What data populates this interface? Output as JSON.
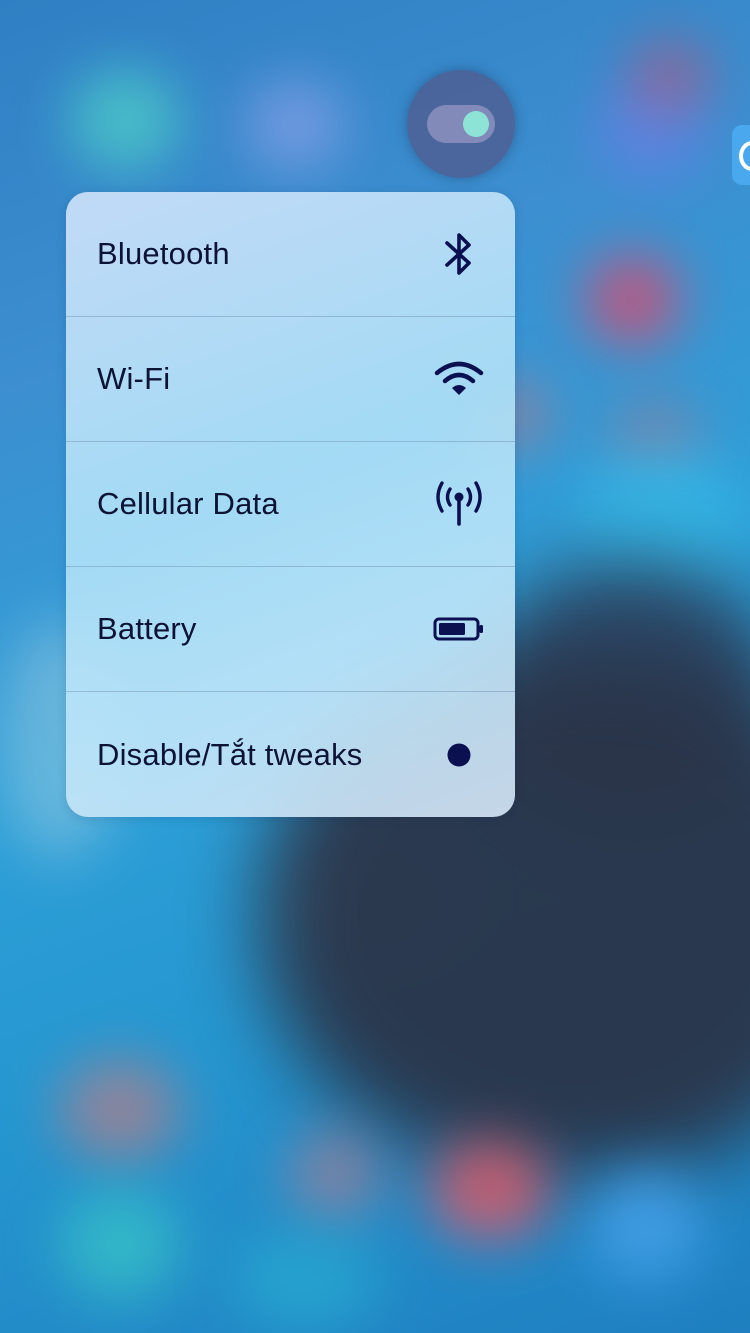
{
  "menu": {
    "items": [
      {
        "label": "Bluetooth",
        "icon": "bluetooth-icon"
      },
      {
        "label": "Wi-Fi",
        "icon": "wifi-icon"
      },
      {
        "label": "Cellular Data",
        "icon": "cellular-antenna-icon"
      },
      {
        "label": "Battery",
        "icon": "battery-icon"
      },
      {
        "label": "Disable/Tắt tweaks",
        "icon": "dot-icon"
      }
    ]
  },
  "source_app": {
    "icon": "toggle-icon"
  },
  "colors": {
    "menu_text": "#0c1334",
    "icon_color": "#0b1150",
    "toggle_knob": "#8de3d6"
  }
}
